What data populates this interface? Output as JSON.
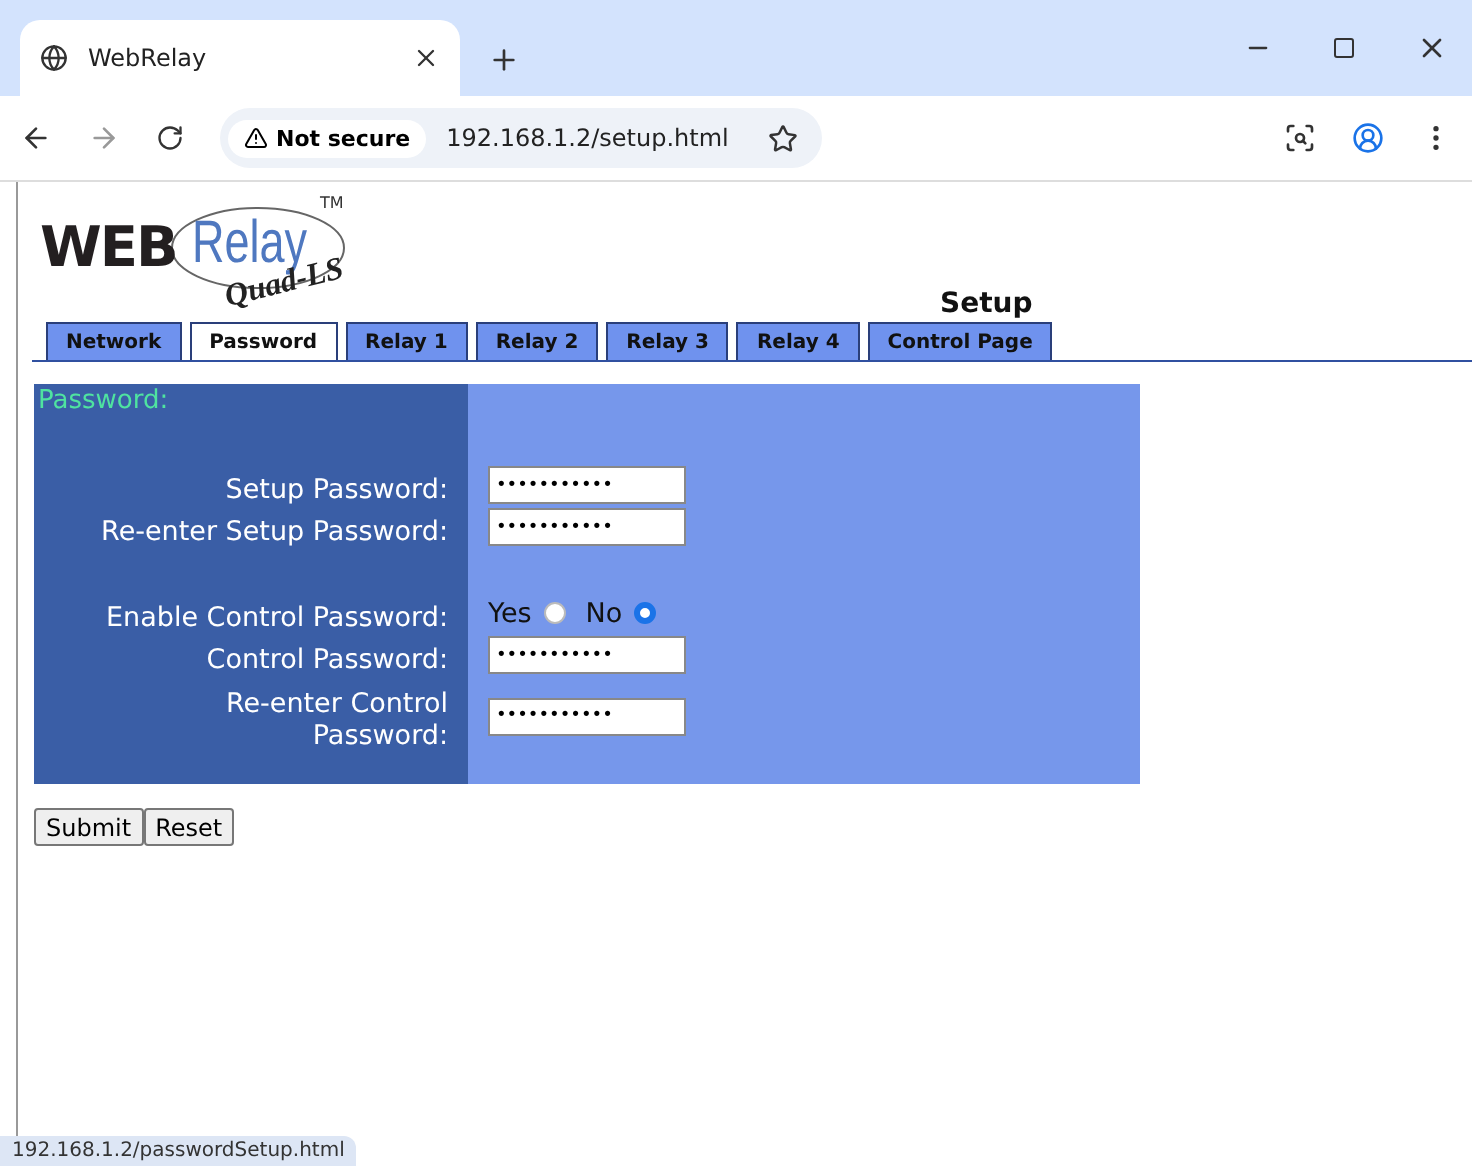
{
  "browser": {
    "tab_title": "WebRelay",
    "security": "Not secure",
    "url": "192.168.1.2/setup.html"
  },
  "logo": {
    "web": "WEB",
    "relay": "Relay",
    "model": "Quad-LS",
    "trademark": "TM"
  },
  "page_title": "Setup",
  "tabs": [
    {
      "label": "Network",
      "selected": false
    },
    {
      "label": "Password",
      "selected": true
    },
    {
      "label": "Relay 1",
      "selected": false
    },
    {
      "label": "Relay 2",
      "selected": false
    },
    {
      "label": "Relay 3",
      "selected": false
    },
    {
      "label": "Relay 4",
      "selected": false
    },
    {
      "label": "Control Page",
      "selected": false
    }
  ],
  "form": {
    "heading": "Password:",
    "rows": [
      {
        "kind": "field",
        "label": "Setup Password:",
        "value": "•••••••••••"
      },
      {
        "kind": "field",
        "label": "Re-enter Setup Password:",
        "value": "•••••••••••"
      },
      {
        "kind": "gap"
      },
      {
        "kind": "radio",
        "label": "Enable Control Password:",
        "options": [
          {
            "label": "Yes",
            "selected": false
          },
          {
            "label": "No",
            "selected": true
          }
        ]
      },
      {
        "kind": "field",
        "label": "Control Password:",
        "value": "•••••••••••"
      },
      {
        "kind": "field",
        "label": "Re-enter Control Password:",
        "value": "•••••••••••"
      }
    ]
  },
  "buttons": [
    "Submit",
    "Reset"
  ],
  "status_bar": "192.168.1.2/passwordSetup.html"
}
